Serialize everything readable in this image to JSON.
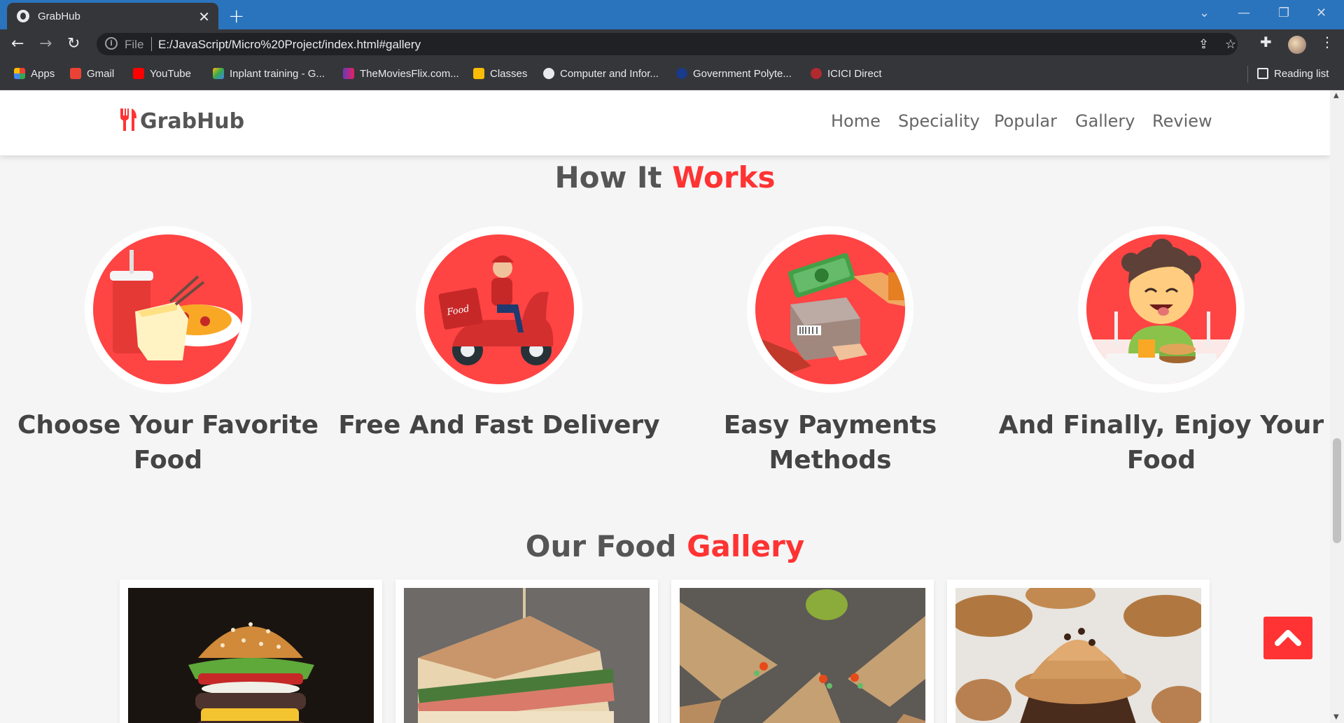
{
  "browser": {
    "tab_title": "GrabHub",
    "tab_close": "✕",
    "new_tab": "+",
    "url_scheme": "File",
    "url": "E:/JavaScript/Micro%20Project/index.html#gallery",
    "bookmarks": [
      "Apps",
      "Gmail",
      "YouTube",
      "Inplant training - G...",
      "TheMoviesFlix.com...",
      "Classes",
      "Computer and Infor...",
      "Government Polyte...",
      "ICICI Direct"
    ],
    "reading_list": "Reading list"
  },
  "site": {
    "logo": "GrabHub",
    "nav": [
      "Home",
      "Speciality",
      "Popular",
      "Gallery",
      "Review"
    ]
  },
  "how_it_works": {
    "title_plain": "How It ",
    "title_highlight": "Works",
    "steps": [
      {
        "label_line1": "Choose Your Favorite",
        "label_line2": "Food",
        "icon": "food-combo-icon"
      },
      {
        "label_line1": "Free And Fast Delivery",
        "label_line2": "",
        "icon": "scooter-delivery-icon"
      },
      {
        "label_line1": "Easy Payments",
        "label_line2": "Methods",
        "icon": "cash-payment-icon"
      },
      {
        "label_line1": "And Finally, Enjoy Your",
        "label_line2": "Food",
        "icon": "happy-eater-icon"
      }
    ]
  },
  "gallery": {
    "title_plain": "Our Food ",
    "title_highlight": "Gallery",
    "items": [
      "burger",
      "sandwich",
      "wraps",
      "cupcakes"
    ]
  },
  "colors": {
    "accent": "#ff3333",
    "tab_bar": "#2a74bd",
    "chrome_dark": "#35363a"
  }
}
